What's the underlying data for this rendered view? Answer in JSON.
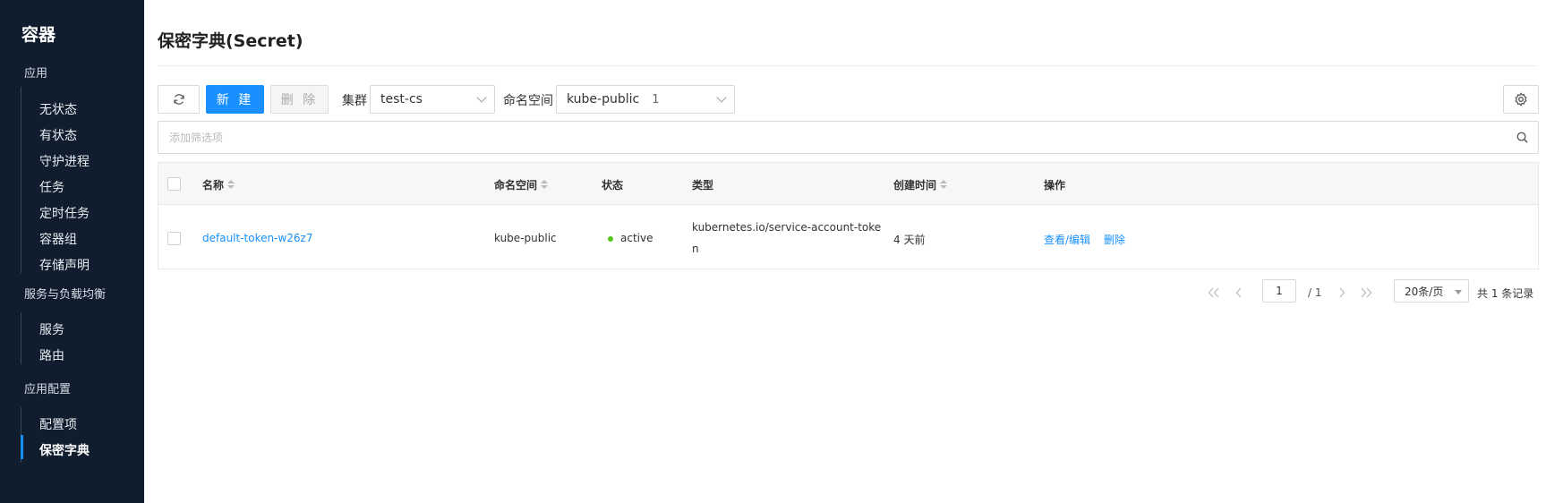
{
  "sidebar": {
    "title": "容器",
    "groups": [
      {
        "label": "应用",
        "items": [
          "无状态",
          "有状态",
          "守护进程",
          "任务",
          "定时任务",
          "容器组",
          "存储声明"
        ]
      },
      {
        "label": "服务与负载均衡",
        "items": [
          "服务",
          "路由"
        ]
      },
      {
        "label": "应用配置",
        "items": [
          "配置项",
          "保密字典"
        ]
      }
    ],
    "active_item": "保密字典"
  },
  "page": {
    "title": "保密字典(Secret)"
  },
  "toolbar": {
    "new_label": "新 建",
    "delete_label": "删 除",
    "cluster_label": "集群",
    "cluster_value": "test-cs",
    "namespace_label": "命名空间",
    "namespace_value": "kube-public",
    "namespace_count": "1"
  },
  "filter": {
    "placeholder": "添加筛选项"
  },
  "table": {
    "headers": {
      "name": "名称",
      "namespace": "命名空间",
      "status": "状态",
      "type": "类型",
      "created": "创建时间",
      "actions": "操作"
    },
    "rows": [
      {
        "name": "default-token-w26z7",
        "namespace": "kube-public",
        "status": "active",
        "type_line1": "kubernetes.io/service-account-toke",
        "type_line2": "n",
        "created": "4 天前",
        "action_edit": "查看/编辑",
        "action_delete": "删除"
      }
    ]
  },
  "pagination": {
    "current_page": "1",
    "total_pages": "/ 1",
    "page_size": "20条/页",
    "total_text": "共 1 条记录"
  },
  "colors": {
    "sidebar_bg": "#0f1d2e",
    "primary": "#1890ff",
    "status_active": "#52c41a"
  },
  "icons": [
    "refresh-icon",
    "settings-icon",
    "search-icon",
    "chevron-down-icon",
    "first-page-icon",
    "prev-page-icon",
    "next-page-icon",
    "last-page-icon"
  ]
}
